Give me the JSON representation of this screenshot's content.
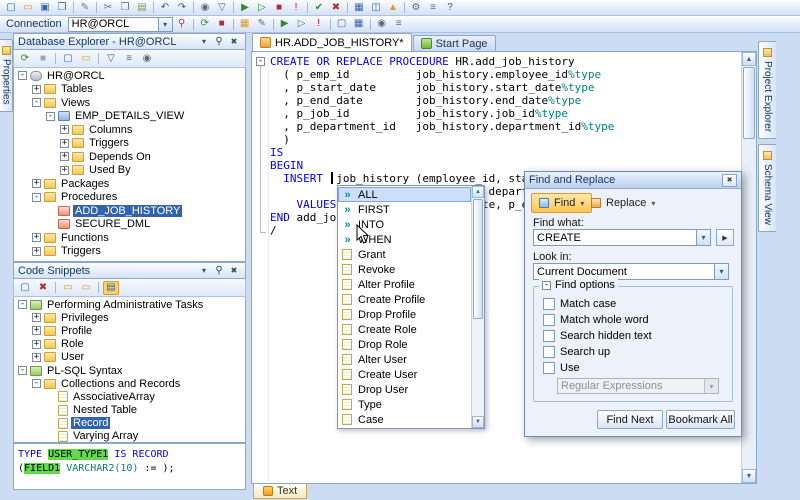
{
  "toolbar_main": {
    "icons": [
      {
        "name": "new-file",
        "glyph": "▢",
        "color": "#2d5fa8"
      },
      {
        "name": "open-file",
        "glyph": "▭",
        "color": "#d79b2c"
      },
      {
        "name": "save",
        "glyph": "▣",
        "color": "#3a66a8"
      },
      {
        "name": "save-all",
        "glyph": "❒",
        "color": "#3a66a8"
      },
      {
        "sep": true
      },
      {
        "name": "new-sql",
        "glyph": "✎",
        "color": "#6a7b94"
      },
      {
        "sep": true
      },
      {
        "name": "cut",
        "glyph": "✂",
        "color": "#5a6b80"
      },
      {
        "name": "copy",
        "glyph": "❐",
        "color": "#5a6b80"
      },
      {
        "name": "paste",
        "glyph": "▤",
        "color": "#7d9a55"
      },
      {
        "sep": true
      },
      {
        "name": "undo",
        "glyph": "↶",
        "color": "#2d5fa8"
      },
      {
        "name": "redo",
        "glyph": "↷",
        "color": "#2d5fa8"
      },
      {
        "sep": true
      },
      {
        "name": "find",
        "glyph": "◉",
        "color": "#5a6b80"
      },
      {
        "name": "filter",
        "glyph": "▽",
        "color": "#3a66a8"
      },
      {
        "sep": true
      },
      {
        "name": "execute",
        "glyph": "▶",
        "color": "#2e8b2e"
      },
      {
        "name": "execute-script",
        "glyph": "▷",
        "color": "#2e8b2e"
      },
      {
        "name": "stop",
        "glyph": "■",
        "color": "#b03030"
      },
      {
        "name": "error-list",
        "glyph": "!",
        "color": "#cc1111"
      },
      {
        "sep": true
      },
      {
        "name": "commit",
        "glyph": "✔",
        "color": "#2e8b2e"
      },
      {
        "name": "rollback",
        "glyph": "✖",
        "color": "#b03030"
      },
      {
        "sep": true
      },
      {
        "name": "table",
        "glyph": "▦",
        "color": "#3a66a8"
      },
      {
        "name": "split-view",
        "glyph": "◫",
        "color": "#3a66a8"
      },
      {
        "name": "chart",
        "glyph": "▲",
        "color": "#d79b2c"
      },
      {
        "sep": true
      },
      {
        "name": "settings",
        "glyph": "⚙",
        "color": "#5a6b80"
      },
      {
        "name": "outline",
        "glyph": "≡",
        "color": "#5a6b80"
      },
      {
        "name": "help",
        "glyph": "?",
        "color": "#2d5fa8"
      }
    ]
  },
  "toolbar_connection": {
    "label": "Connection",
    "value": "HR@ORCL",
    "icons": [
      {
        "name": "pin",
        "glyph": "⚲",
        "color": "#c03a2b"
      },
      {
        "sep": true
      },
      {
        "name": "refresh",
        "glyph": "⟳",
        "color": "#2e8b2e"
      },
      {
        "name": "stop-refresh",
        "glyph": "■",
        "color": "#b03030"
      },
      {
        "sep": true
      },
      {
        "name": "new-connection",
        "glyph": "▦",
        "color": "#d79b2c"
      },
      {
        "name": "edit-connection",
        "glyph": "✎",
        "color": "#5a6b80"
      },
      {
        "sep": true
      },
      {
        "name": "execute-current",
        "glyph": "▶",
        "color": "#2e8b2e"
      },
      {
        "name": "debug",
        "glyph": "▷",
        "color": "#5a6b80"
      },
      {
        "name": "validate",
        "glyph": "!",
        "color": "#cc1111"
      },
      {
        "sep": true
      },
      {
        "name": "document",
        "glyph": "▢",
        "color": "#3a66a8"
      },
      {
        "name": "results-grid",
        "glyph": "▦",
        "color": "#3a66a8"
      },
      {
        "sep": true
      },
      {
        "name": "zoom",
        "glyph": "◉",
        "color": "#5a6b80"
      },
      {
        "name": "list",
        "glyph": "≡",
        "color": "#5a6b80"
      }
    ]
  },
  "side_tabs": {
    "left": [
      {
        "label": "Properties"
      }
    ],
    "right": [
      {
        "label": "Project Explorer"
      },
      {
        "label": "Schema View"
      }
    ]
  },
  "database_explorer": {
    "title": "Database Explorer - HR@ORCL",
    "toolbar_icons": [
      {
        "name": "refresh",
        "glyph": "⟳",
        "color": "#2e8b2e"
      },
      {
        "name": "stop",
        "glyph": "■",
        "color": "#9aa6b8"
      },
      {
        "sep": true
      },
      {
        "name": "new-object",
        "glyph": "▢",
        "color": "#3a66a8"
      },
      {
        "name": "open-object",
        "glyph": "▭",
        "color": "#d79b2c"
      },
      {
        "sep": true
      },
      {
        "name": "filter",
        "glyph": "▽",
        "color": "#3a66a8"
      },
      {
        "name": "properties",
        "glyph": "≡",
        "color": "#5a6b80"
      },
      {
        "name": "search",
        "glyph": "◉",
        "color": "#5a6b80"
      }
    ],
    "tree": [
      {
        "label": "HR@ORCL",
        "level": 0,
        "exp": "-",
        "icon": "db"
      },
      {
        "label": "Tables",
        "level": 1,
        "exp": "+",
        "icon": "folder"
      },
      {
        "label": "Views",
        "level": 1,
        "exp": "-",
        "icon": "folder"
      },
      {
        "label": "EMP_DETAILS_VIEW",
        "level": 2,
        "exp": "-",
        "icon": "view"
      },
      {
        "label": "Columns",
        "level": 3,
        "exp": "+",
        "icon": "folder"
      },
      {
        "label": "Triggers",
        "level": 3,
        "exp": "+",
        "icon": "folder"
      },
      {
        "label": "Depends On",
        "level": 3,
        "exp": "+",
        "icon": "folder"
      },
      {
        "label": "Used By",
        "level": 3,
        "exp": "+",
        "icon": "folder"
      },
      {
        "label": "Packages",
        "level": 1,
        "exp": "+",
        "icon": "folder"
      },
      {
        "label": "Procedures",
        "level": 1,
        "exp": "-",
        "icon": "folder"
      },
      {
        "label": "ADD_JOB_HISTORY",
        "level": 2,
        "exp": null,
        "icon": "proc",
        "selected": true
      },
      {
        "label": "SECURE_DML",
        "level": 2,
        "exp": null,
        "icon": "proc"
      },
      {
        "label": "Functions",
        "level": 1,
        "exp": "+",
        "icon": "folder"
      },
      {
        "label": "Triggers",
        "level": 1,
        "exp": "+",
        "icon": "folder"
      }
    ]
  },
  "code_snippets": {
    "title": "Code Snippets",
    "toolbar_icons": [
      {
        "name": "new-snippet",
        "glyph": "▢",
        "color": "#3a66a8"
      },
      {
        "name": "delete-snippet",
        "glyph": "✖",
        "color": "#b03030"
      },
      {
        "sep": true
      },
      {
        "name": "new-folder",
        "glyph": "▭",
        "color": "#d79b2c"
      },
      {
        "name": "open-folder",
        "glyph": "▭",
        "color": "#d79b2c"
      },
      {
        "sep": true
      },
      {
        "name": "view-mode",
        "glyph": "▤",
        "color": "#3a66a8",
        "active": true
      }
    ],
    "tree": [
      {
        "label": "Performing Administrative Tasks",
        "level": 0,
        "exp": "-",
        "icon": "cat"
      },
      {
        "label": "Privileges",
        "level": 1,
        "exp": "+",
        "icon": "folder"
      },
      {
        "label": "Profile",
        "level": 1,
        "exp": "+",
        "icon": "folder"
      },
      {
        "label": "Role",
        "level": 1,
        "exp": "+",
        "icon": "folder"
      },
      {
        "label": "User",
        "level": 1,
        "exp": "+",
        "icon": "folder"
      },
      {
        "label": "PL-SQL Syntax",
        "level": 0,
        "exp": "-",
        "icon": "cat"
      },
      {
        "label": "Collections and Records",
        "level": 1,
        "exp": "-",
        "icon": "folder"
      },
      {
        "label": "AssociativeArray",
        "level": 2,
        "exp": null,
        "icon": "snippet"
      },
      {
        "label": "Nested Table",
        "level": 2,
        "exp": null,
        "icon": "snippet"
      },
      {
        "label": "Record",
        "level": 2,
        "exp": null,
        "icon": "snippet",
        "selected": true
      },
      {
        "label": "Varying Array",
        "level": 2,
        "exp": null,
        "icon": "snippet"
      }
    ],
    "preview_lines": [
      [
        [
          "TYPE",
          "kw"
        ],
        [
          " ",
          "pl"
        ],
        [
          "USER_TYPE1",
          "hl"
        ],
        [
          " ",
          "pl"
        ],
        [
          "IS RECORD",
          "kw"
        ]
      ],
      [
        [
          "(",
          "pl"
        ],
        [
          "FIELD1",
          "hl"
        ],
        [
          " ",
          "pl"
        ],
        [
          "VARCHAR2(10)",
          "tp"
        ],
        [
          " := );",
          "pl"
        ]
      ]
    ]
  },
  "editor": {
    "tabs": [
      {
        "label": "HR.ADD_JOB_HISTORY*"
      },
      {
        "label": "Start Page"
      }
    ],
    "bottom_tab_label": "Text",
    "code_lines": [
      [
        [
          "CREATE OR REPLACE PROCEDURE",
          "k"
        ],
        [
          " HR.add_job_history",
          "p"
        ]
      ],
      [
        [
          "  ( p_emp_id          job_history.employee_id",
          "p"
        ],
        [
          "%type",
          "t"
        ]
      ],
      [
        [
          "  , p_start_date      job_history.start_date",
          "p"
        ],
        [
          "%type",
          "t"
        ]
      ],
      [
        [
          "  , p_end_date        job_history.end_date",
          "p"
        ],
        [
          "%type",
          "t"
        ]
      ],
      [
        [
          "  , p_job_id          job_history.job_id",
          "p"
        ],
        [
          "%type",
          "t"
        ]
      ],
      [
        [
          "  , p_department_id   job_history.department_id",
          "p"
        ],
        [
          "%type",
          "t"
        ]
      ],
      [
        [
          "  )",
          "p"
        ]
      ],
      [
        [
          "IS",
          "k"
        ]
      ],
      [
        [
          "BEGIN",
          "k"
        ]
      ],
      [
        [
          "  ",
          "p"
        ],
        [
          "INSERT",
          "k"
        ],
        [
          "  job_history (employee_id, start_date, end_date, job_id,",
          "p"
        ]
      ],
      [
        [
          "                                 department_id)",
          "p"
        ]
      ],
      [
        [
          "    ",
          "p"
        ],
        [
          "VALUES",
          "k"
        ],
        [
          " (p_emp_id, p_start_date, p_end_date, p_job_id, p_department_id);",
          "p"
        ]
      ],
      [
        [
          "END",
          "k"
        ],
        [
          " add_job_history;",
          "p"
        ]
      ],
      [
        [
          "/",
          "p"
        ]
      ]
    ]
  },
  "autocomplete": {
    "items": [
      {
        "label": "ALL",
        "kind": "keyword",
        "selected": true
      },
      {
        "label": "FIRST",
        "kind": "keyword"
      },
      {
        "label": "INTO",
        "kind": "keyword"
      },
      {
        "label": "WHEN",
        "kind": "keyword"
      },
      {
        "label": "Grant",
        "kind": "snippet"
      },
      {
        "label": "Revoke",
        "kind": "snippet"
      },
      {
        "label": "Alter Profile",
        "kind": "snippet"
      },
      {
        "label": "Create Profile",
        "kind": "snippet"
      },
      {
        "label": "Drop Profile",
        "kind": "snippet"
      },
      {
        "label": "Create Role",
        "kind": "snippet"
      },
      {
        "label": "Drop Role",
        "kind": "snippet"
      },
      {
        "label": "Alter User",
        "kind": "snippet"
      },
      {
        "label": "Create User",
        "kind": "snippet"
      },
      {
        "label": "Drop User",
        "kind": "snippet"
      },
      {
        "label": "Type",
        "kind": "snippet"
      },
      {
        "label": "Case",
        "kind": "snippet"
      }
    ]
  },
  "find_dialog": {
    "title": "Find and Replace",
    "find_button": "Find",
    "replace_button": "Replace",
    "find_what_label": "Find what:",
    "find_what_value": "CREATE",
    "look_in_label": "Look in:",
    "look_in_value": "Current Document",
    "options_title": "Find options",
    "options": [
      "Match case",
      "Match whole word",
      "Search hidden text",
      "Search up",
      "Use"
    ],
    "use_combo_value": "Regular Expressions",
    "find_next_button": "Find Next",
    "bookmark_all_button": "Bookmark All"
  }
}
